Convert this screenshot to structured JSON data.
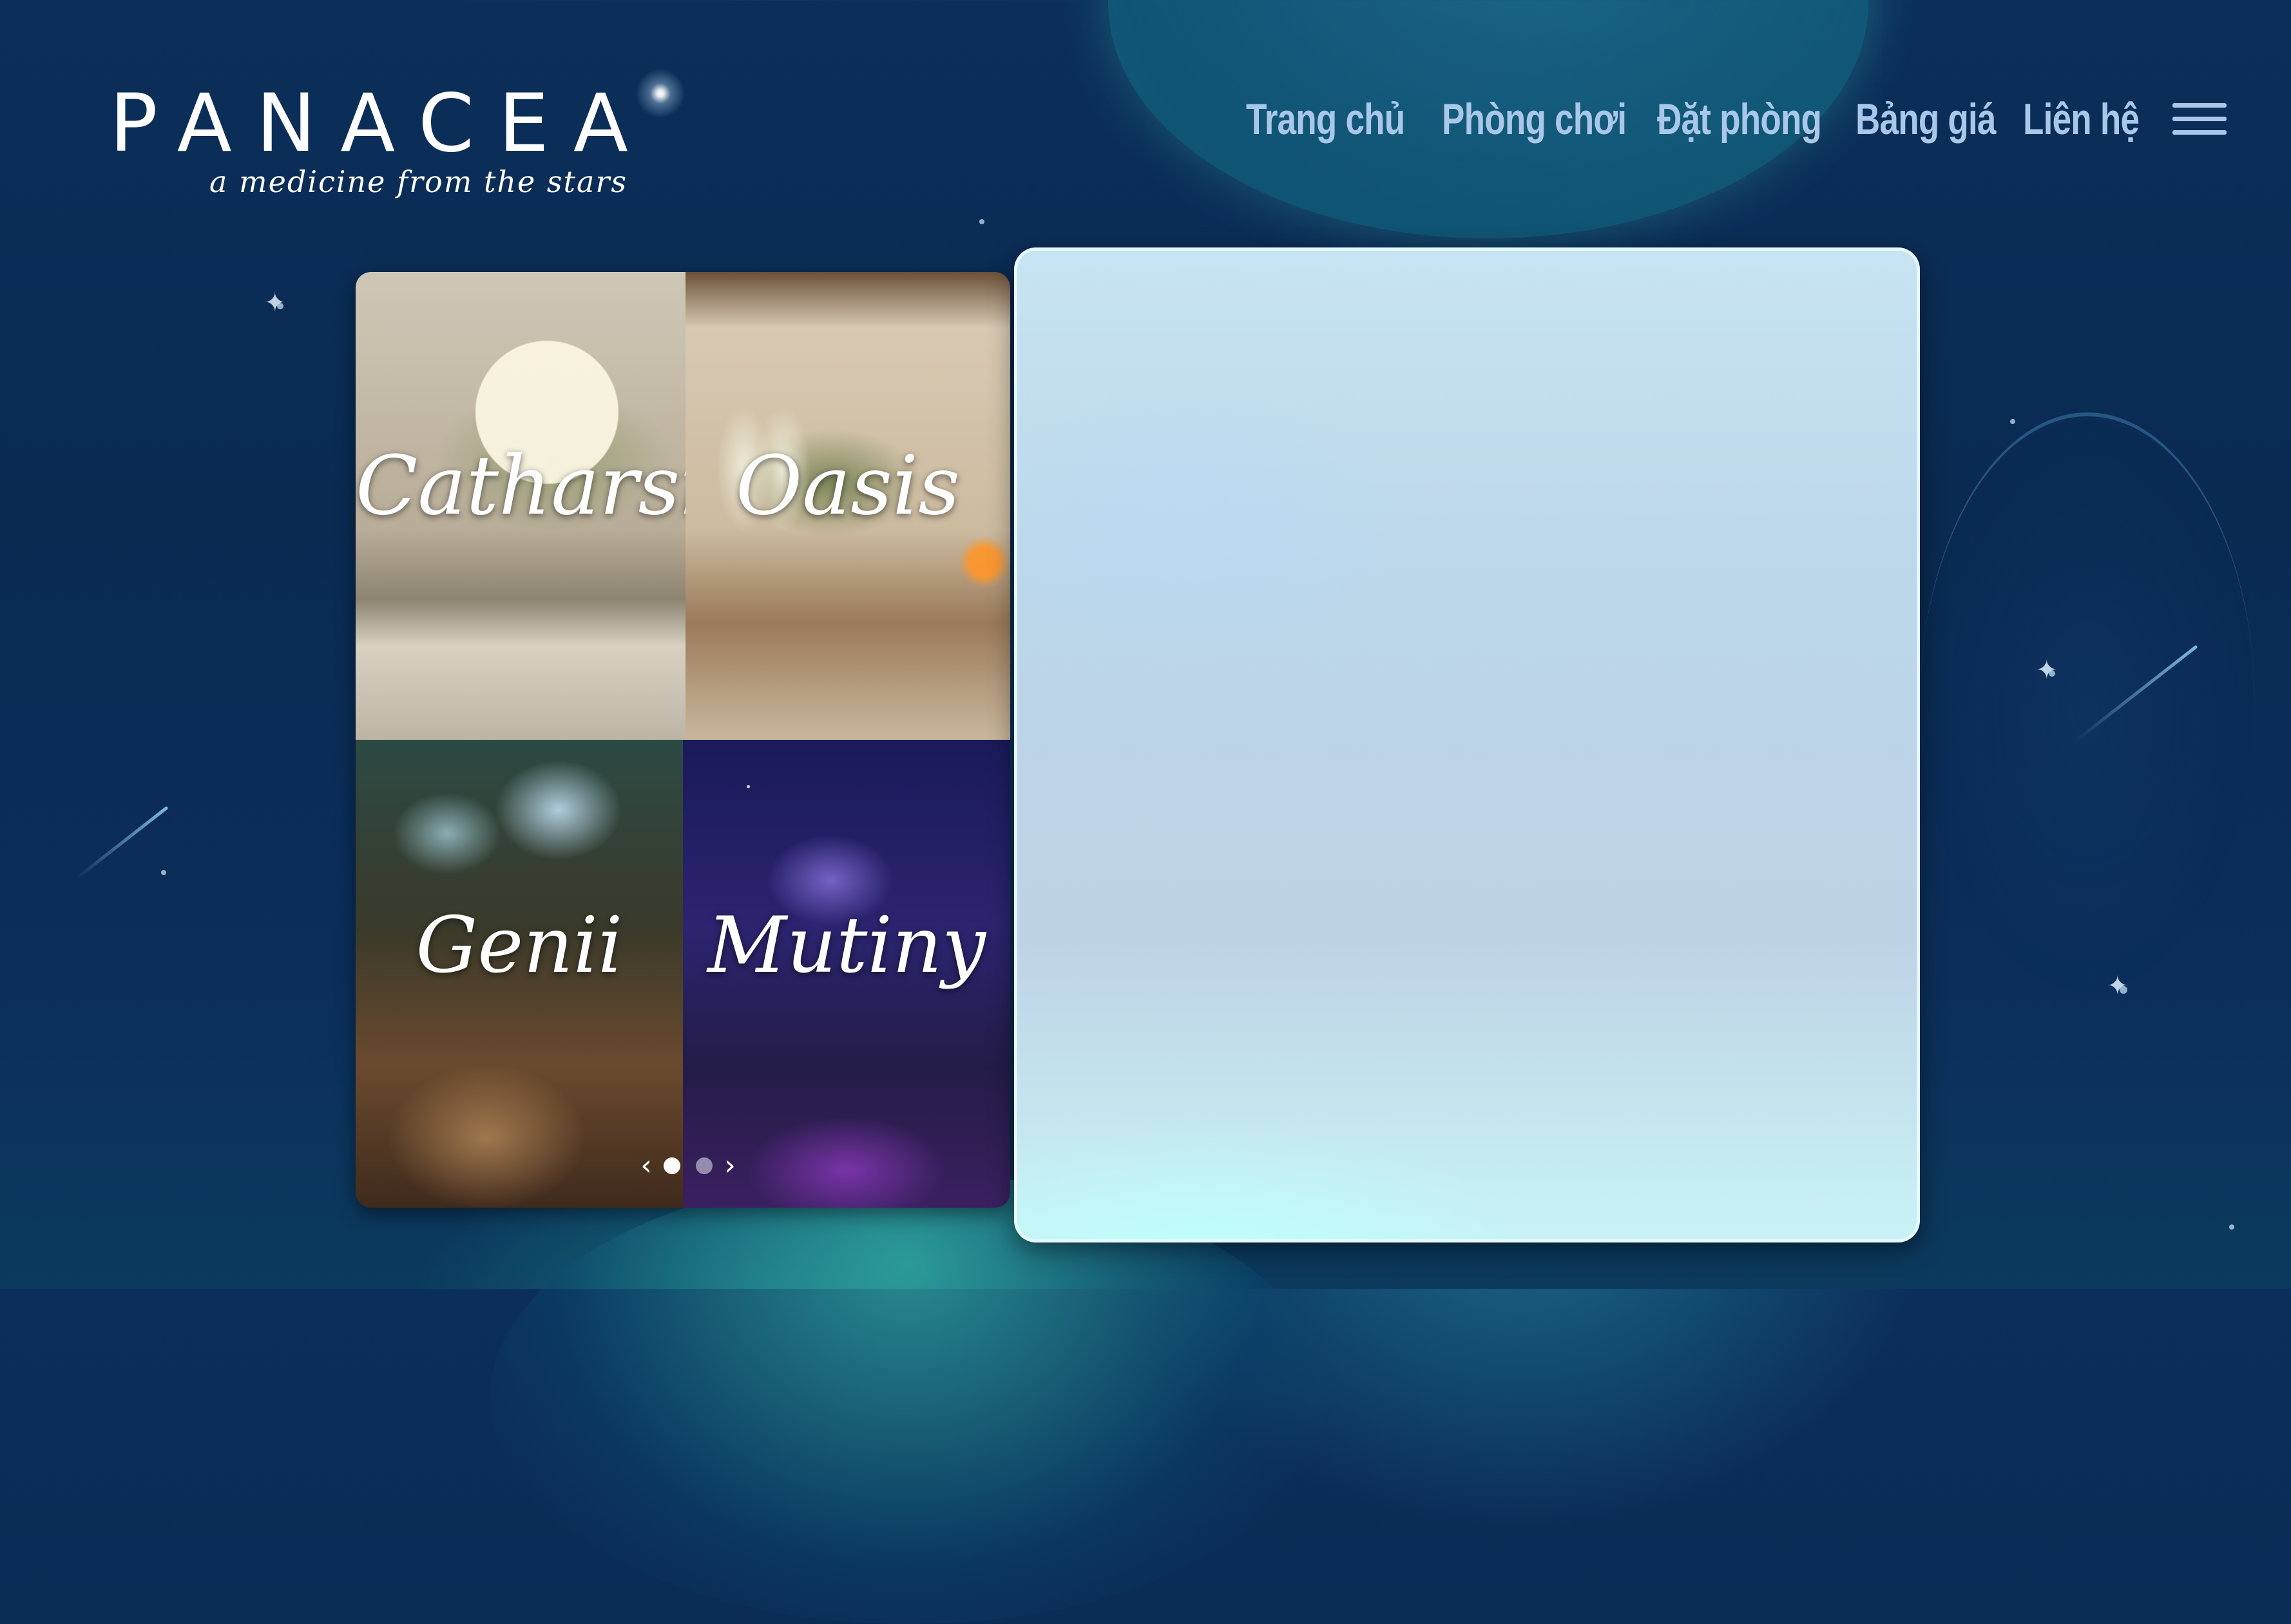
{
  "brand": {
    "name": "PANACEA",
    "tagline": "a medicine from the stars"
  },
  "nav": {
    "items": [
      {
        "label": "Trang chủ"
      },
      {
        "label": "Phòng chơi"
      },
      {
        "label": "Đặt phòng"
      },
      {
        "label": "Bảng giá"
      },
      {
        "label": "Liên hệ"
      }
    ],
    "menu_icon": "hamburger-menu-icon"
  },
  "gallery": {
    "rooms": [
      {
        "name": "Catharsis"
      },
      {
        "name": "Oasis"
      },
      {
        "name": "Genii"
      },
      {
        "name": "Mutiny"
      }
    ],
    "controls": {
      "prev_icon": "chevron-left-icon",
      "next_icon": "chevron-right-icon",
      "prev_glyph": "‹",
      "next_glyph": "›",
      "pages": 2,
      "active_page": 1
    }
  },
  "colors": {
    "background": "#0b2f5a",
    "nav_text": "#a9c7e9",
    "panel": "#c2dbed"
  }
}
